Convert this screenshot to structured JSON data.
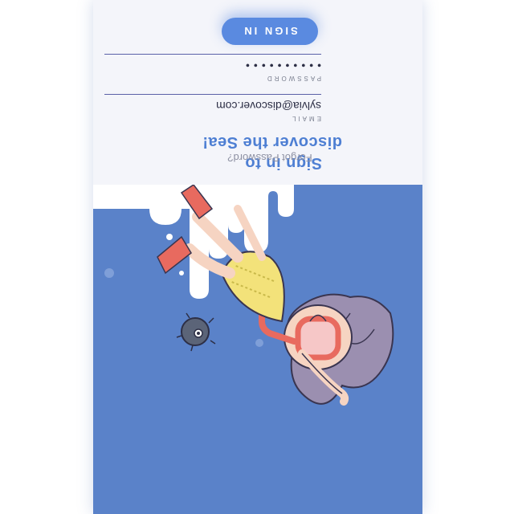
{
  "login": {
    "title_line1": "Sign in to",
    "title_line2": "discover the Sea!",
    "email_label": "EMAIL",
    "email_value": "sylvia@discover.com",
    "password_label": "PASSWORD",
    "password_value": "••••••••••",
    "signin_label": "SIGN IN",
    "forgot_label": "Forgot Password?"
  },
  "colors": {
    "hero_background": "#5a82c9",
    "card_background": "#f4f5fa",
    "accent": "#4e7fd3",
    "button": "#5a8ae0",
    "snorkel_mask": "#e86a5f",
    "swimsuit": "#f3e27a",
    "hair": "#9b8fb0"
  },
  "illustration": {
    "subject": "girl-snorkeling-diver",
    "companion": "pufferfish"
  }
}
